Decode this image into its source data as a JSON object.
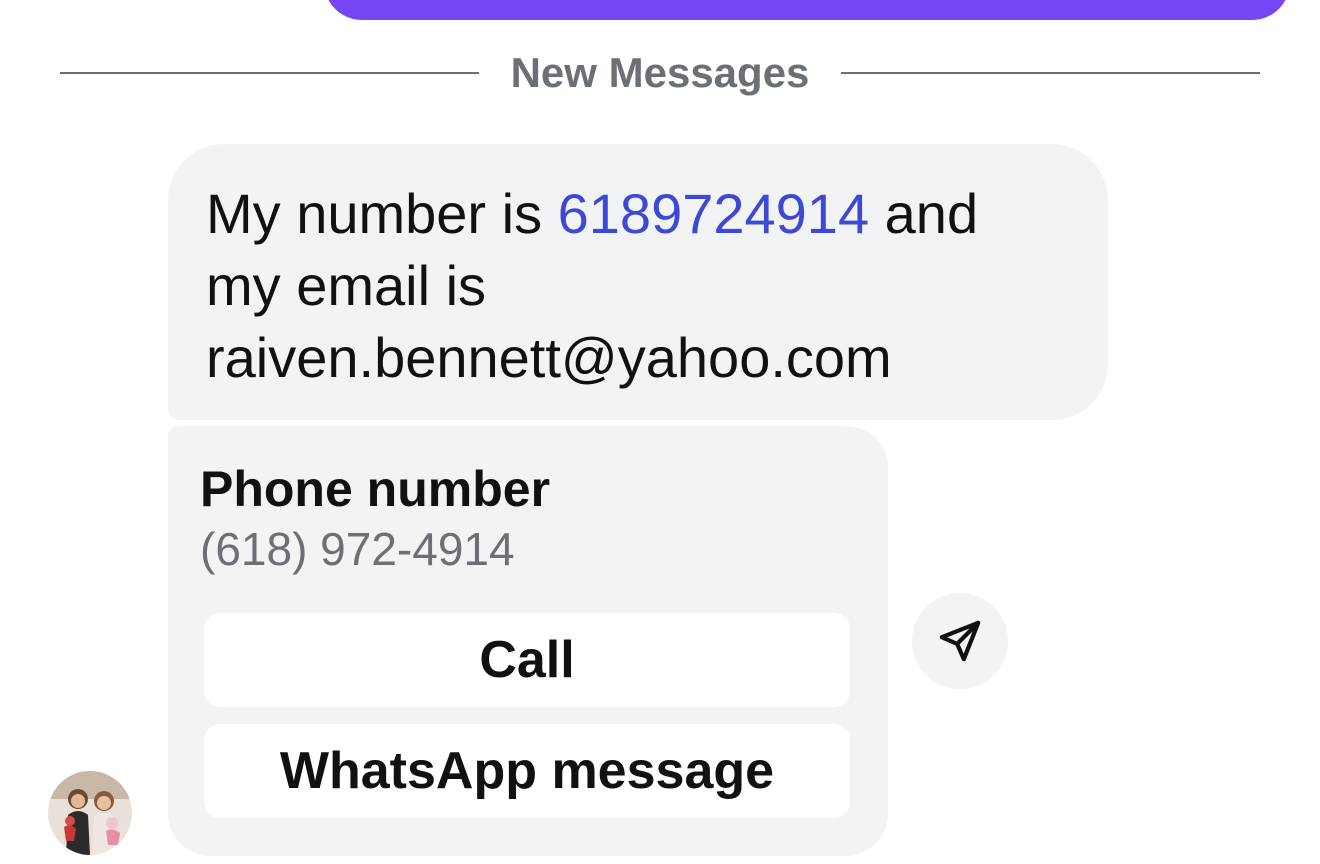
{
  "divider": {
    "label": "New Messages"
  },
  "message": {
    "prefix": "My number is ",
    "phone_link": "6189724914",
    "suffix_line1": " and",
    "line2": "my email is",
    "line3": "raiven.bennett@yahoo.com"
  },
  "contact_card": {
    "title": "Phone number",
    "number": "(618) 972-4914",
    "call_label": "Call",
    "whatsapp_label": "WhatsApp message"
  },
  "icons": {
    "share": "send-icon",
    "avatar": "avatar"
  },
  "colors": {
    "outgoing_bubble": "#7646f5",
    "incoming_bubble": "#f2f3f5",
    "link": "#3d49d6",
    "muted": "#6b7077"
  }
}
